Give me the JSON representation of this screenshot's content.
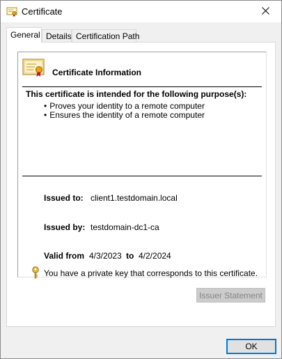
{
  "window": {
    "title": "Certificate",
    "title_icon": "certificate-icon",
    "close_icon": "close-icon"
  },
  "tabs": [
    {
      "label": "General",
      "active": true
    },
    {
      "label": "Details",
      "active": false
    },
    {
      "label": "Certification Path",
      "active": false
    }
  ],
  "general": {
    "heading": "Certificate Information",
    "purpose_title": "This certificate is intended for the following purpose(s):",
    "purposes": [
      "Proves your identity to a remote computer",
      "Ensures the identity of a remote computer"
    ],
    "issued_to_label": "Issued to:",
    "issued_to_value": "client1.testdomain.local",
    "issued_by_label": "Issued by:",
    "issued_by_value": "testdomain-dc1-ca",
    "valid_from_label": "Valid from",
    "valid_from_value": "4/3/2023",
    "valid_to_label": "to",
    "valid_to_value": "4/2/2024",
    "key_note": "You have a private key that corresponds to this certificate."
  },
  "buttons": {
    "issuer_statement": "Issuer Statement",
    "ok": "OK"
  },
  "colors": {
    "focus_border": "#0078d7",
    "disabled_text": "#838383"
  }
}
